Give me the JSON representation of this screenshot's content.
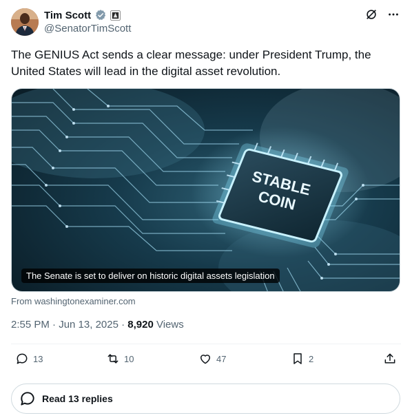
{
  "author": {
    "display_name": "Tim Scott",
    "handle": "@SenatorTimScott"
  },
  "tweet": {
    "text": "The GENIUS Act sends a clear message: under President Trump, the United States will lead in the digital asset revolution."
  },
  "media": {
    "chip_text_line1": "STABLE",
    "chip_text_line2": "COIN",
    "caption": "The Senate is set to deliver on historic digital assets legislation",
    "source": "From washingtonexaminer.com"
  },
  "meta": {
    "timestamp": "2:55 PM · Jun 13, 2025 · ",
    "views_count": "8,920",
    "views_label": " Views"
  },
  "actions": {
    "replies": "13",
    "reposts": "10",
    "likes": "47",
    "bookmarks": "2"
  },
  "read_replies": {
    "label": "Read 13 replies"
  },
  "icons": {
    "verified": "verified-badge-icon",
    "affiliation": "senate-seal-icon",
    "grok": "grok-icon",
    "more": "more-icon",
    "reply": "reply-icon",
    "repost": "repost-icon",
    "like": "like-icon",
    "bookmark": "bookmark-icon",
    "share": "share-icon"
  },
  "colors": {
    "verified": "#829aab",
    "secondary_text": "#536471",
    "border": "#cfd9de"
  }
}
